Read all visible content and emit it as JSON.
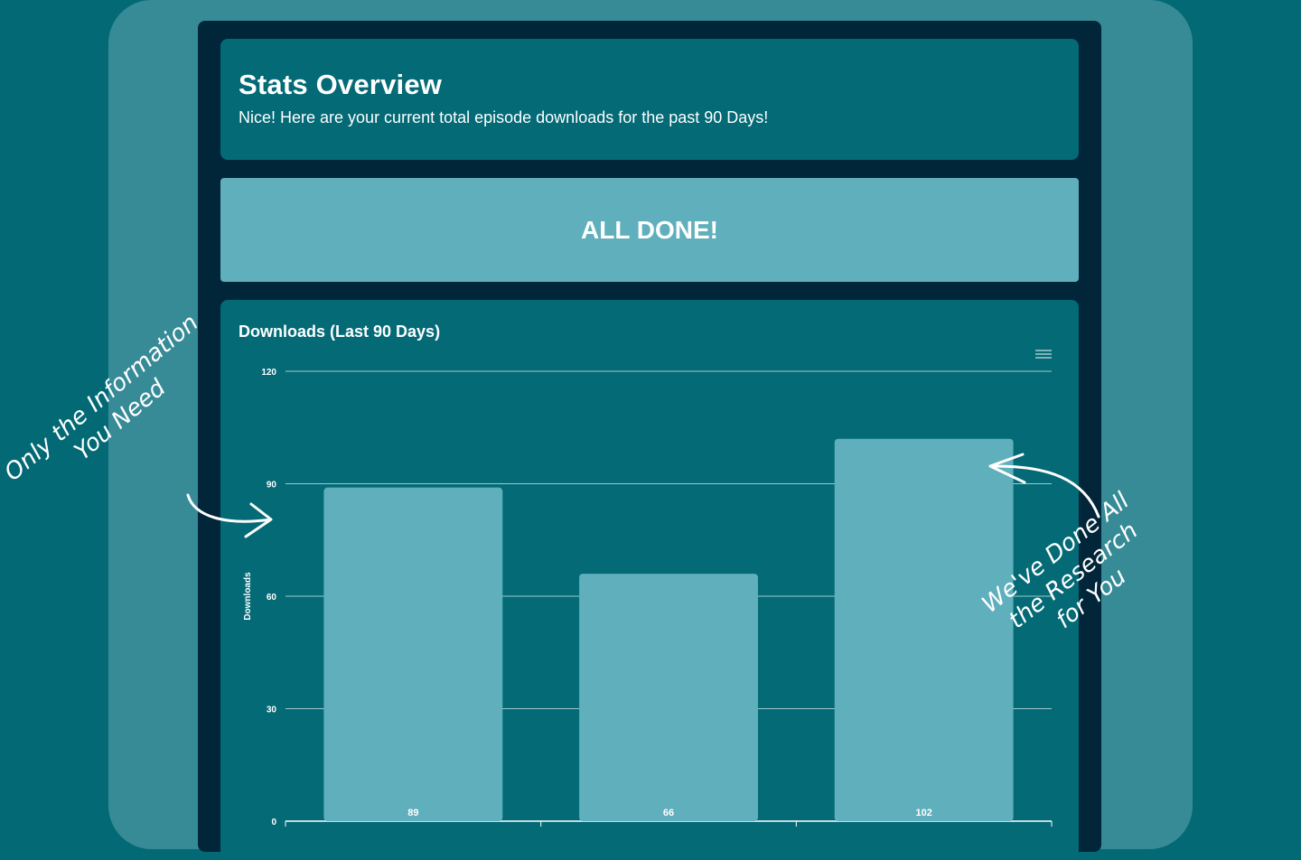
{
  "header": {
    "title": "Stats Overview",
    "subtitle": "Nice! Here are your current total episode downloads for the past 90 Days!"
  },
  "all_done_label": "ALL DONE!",
  "chart_card": {
    "title": "Downloads (Last 90 Days)",
    "menu_icon": "hamburger-menu-icon"
  },
  "chart_data": {
    "type": "bar",
    "title": "Downloads (Last 90 Days)",
    "ylabel": "Downloads",
    "xlabel": "",
    "categories": [
      "",
      "",
      ""
    ],
    "values": [
      89,
      66,
      102
    ],
    "ylim": [
      0,
      120
    ],
    "yticks": [
      0,
      30,
      60,
      90,
      120
    ],
    "grid": true,
    "data_labels": true,
    "bar_color": "#5fafbc"
  },
  "annotations": {
    "left": [
      "Only the Information",
      "You Need"
    ],
    "right": [
      "We've Done All",
      "the Research",
      "for You"
    ]
  },
  "colors": {
    "background": "#036a75",
    "panel": "#368b97",
    "device": "#01263a",
    "card": "#036a76",
    "accent": "#5fafbc"
  }
}
